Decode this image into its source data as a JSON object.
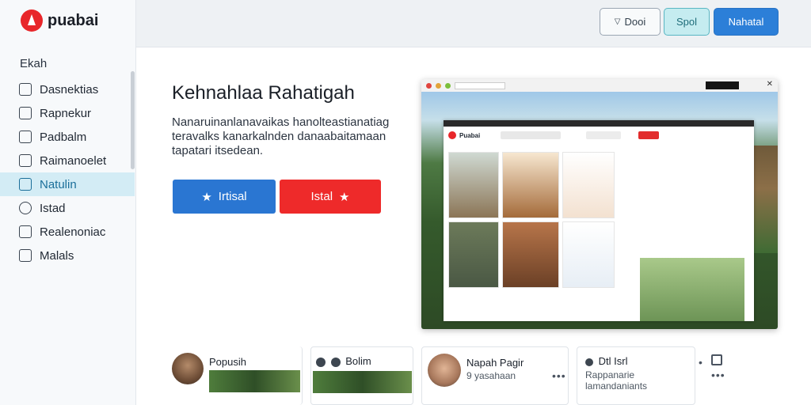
{
  "app": {
    "logo_text": "puabai",
    "brand_color": "#e8262a"
  },
  "header": {
    "btn_outline_label": "Dooi",
    "btn_teal_label": "Spol",
    "btn_primary_label": "Nahatal"
  },
  "sidebar": {
    "heading": "Ekah",
    "items": [
      {
        "label": "Dasnektias",
        "icon": "check-square-icon"
      },
      {
        "label": "Rapnekur",
        "icon": "bookmark-icon"
      },
      {
        "label": "Padbalm",
        "icon": "page-icon"
      },
      {
        "label": "Raimanoelet",
        "icon": "square-icon"
      },
      {
        "label": "Natulin",
        "icon": "folder-icon",
        "active": true
      },
      {
        "label": "Istad",
        "icon": "clock-icon"
      },
      {
        "label": "Realenoniac",
        "icon": "checkbox-icon"
      },
      {
        "label": "Malals",
        "icon": "checkbox-icon"
      }
    ]
  },
  "hero": {
    "title": "Kehnahlaa Rahatigah",
    "description": "Nanaruinanlanavaikas hanolteastianatiag teravalks kanarkalnden danaabaitamaan tapatari itsedean.",
    "cta_primary": "Irtisal",
    "cta_secondary": "Istal"
  },
  "preview": {
    "logo_text": "Puabai"
  },
  "cards": [
    {
      "title": "Popusih"
    },
    {
      "title": "Bolim"
    },
    {
      "title": "Napah Pagir",
      "sub": "9 yasahaan"
    },
    {
      "title": "Dtl Isrl",
      "sub": "Rappanarie lamandaniants"
    }
  ],
  "colors": {
    "accent_blue": "#2a76d2",
    "accent_red": "#ee2a2a",
    "active_item": "#d3ecf5"
  }
}
